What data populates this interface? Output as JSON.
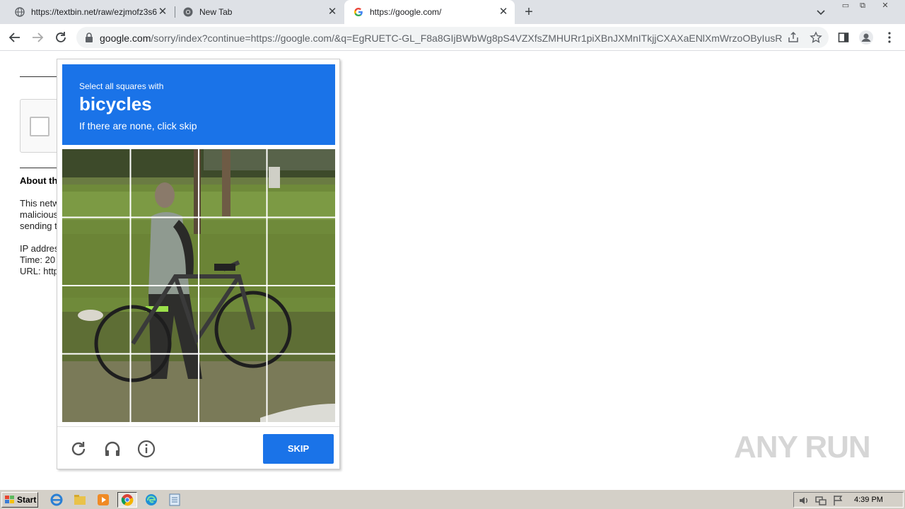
{
  "tabs": [
    {
      "title": "https://textbin.net/raw/ezjmofz3s6",
      "active": false,
      "icon": "globe-icon"
    },
    {
      "title": "New Tab",
      "active": false,
      "icon": "chrome-icon"
    },
    {
      "title": "https://google.com/",
      "active": true,
      "icon": "google-icon"
    }
  ],
  "address_bar": {
    "host": "google.com",
    "path": "/sorry/index?continue=https://google.com/&q=EgRUETC-GL_F8a8GIjBWbWg8pS4VZXfsZMHURr1piXBnJXMnITkjjCXAXaENlXmWrzoOByIusRP..."
  },
  "page": {
    "about_heading": "About th",
    "paragraph_lines": [
      "This netw",
      "malicious",
      "sending t"
    ],
    "info_lines": [
      "IP addres",
      "Time: 20",
      "URL: http"
    ]
  },
  "challenge": {
    "instruction": "Select all squares with",
    "target": "bicycles",
    "hint": "If there are none, click skip",
    "skip_label": "SKIP",
    "grid_size": 4
  },
  "watermark": "ANY RUN",
  "taskbar": {
    "start_label": "Start",
    "clock": "4:39 PM",
    "apps": [
      "ie-icon",
      "explorer-icon",
      "media-player-icon",
      "chrome-icon",
      "edge-icon",
      "notepad-icon"
    ]
  },
  "colors": {
    "accent": "#1a73e8",
    "tabstrip": "#dee1e6",
    "taskbar": "#d4d0c8"
  }
}
